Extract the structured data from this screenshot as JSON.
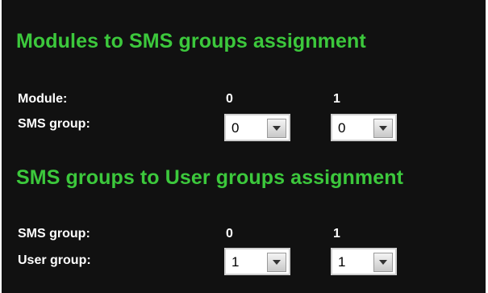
{
  "section1": {
    "title": "Modules to SMS groups assignment",
    "row1_label": "Module:",
    "row2_label": "SMS group:",
    "columns": [
      "0",
      "1"
    ],
    "selects": [
      {
        "value": "0",
        "icon": "chevron-down-icon"
      },
      {
        "value": "0",
        "icon": "chevron-down-icon"
      }
    ]
  },
  "section2": {
    "title": "SMS groups to User groups assignment",
    "row1_label": "SMS group:",
    "row2_label": "User group:",
    "columns": [
      "0",
      "1"
    ],
    "selects": [
      {
        "value": "1",
        "icon": "chevron-down-icon"
      },
      {
        "value": "1",
        "icon": "chevron-down-icon"
      }
    ]
  },
  "colors": {
    "background": "#111111",
    "heading": "#3cc83c",
    "label": "#ffffff"
  }
}
